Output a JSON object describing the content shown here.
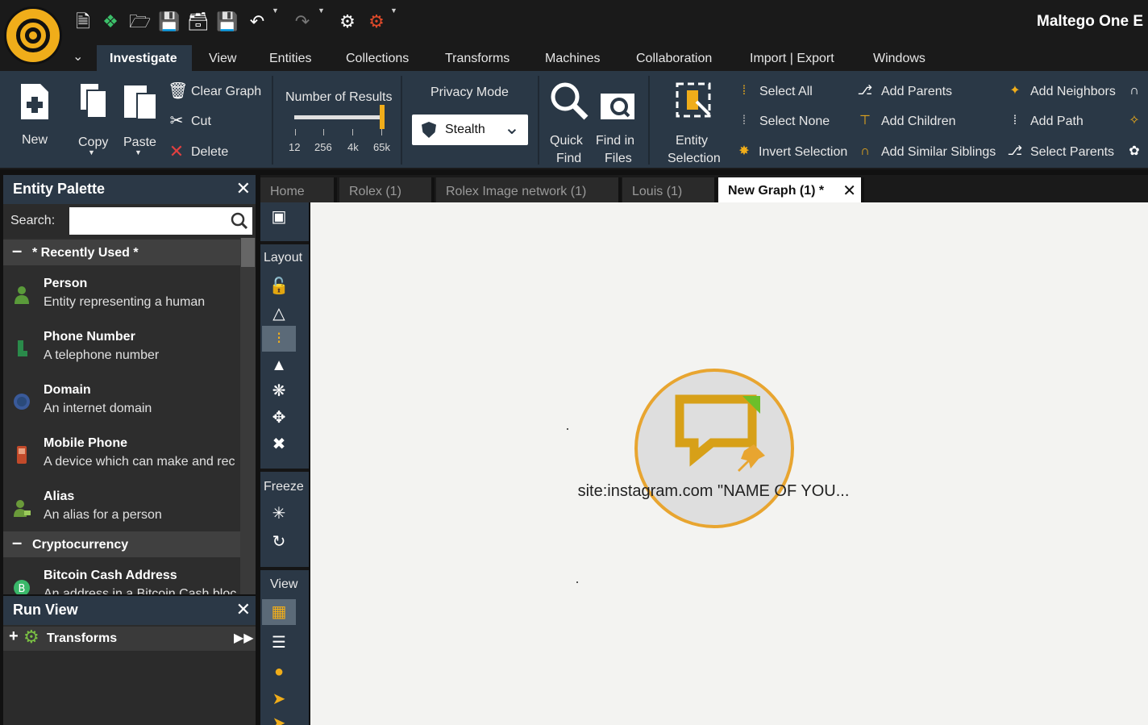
{
  "app": {
    "title": "Maltego One E"
  },
  "menu": {
    "tabs": [
      "Investigate",
      "View",
      "Entities",
      "Collections",
      "Transforms",
      "Machines",
      "Collaboration",
      "Import | Export",
      "Windows"
    ],
    "active": "Investigate"
  },
  "ribbon": {
    "new": "New",
    "copy": "Copy",
    "paste": "Paste",
    "clear_graph": "Clear Graph",
    "cut": "Cut",
    "delete": "Delete",
    "number_of_results": "Number of Results",
    "results_ticks": [
      "12",
      "256",
      "4k",
      "65k"
    ],
    "results_level": 1.0,
    "privacy_mode": "Privacy Mode",
    "privacy_value": "Stealth",
    "quick_find_1": "Quick",
    "quick_find_2": "Find",
    "find_files_1": "Find in",
    "find_files_2": "Files",
    "entity_sel_1": "Entity",
    "entity_sel_2": "Selection",
    "select_all": "Select All",
    "select_none": "Select None",
    "invert_selection": "Invert Selection",
    "add_parents": "Add Parents",
    "add_children": "Add Children",
    "add_similar_siblings": "Add Similar Siblings",
    "add_neighbors": "Add Neighbors",
    "add_path": "Add Path",
    "select_parents": "Select Parents"
  },
  "palette": {
    "title": "Entity Palette",
    "search_label": "Search:",
    "search_value": "",
    "categories": [
      {
        "label": "* Recently Used *",
        "entities": [
          {
            "name": "Person",
            "desc": "Entity representing a human",
            "icon": "person-icon"
          },
          {
            "name": "Phone Number",
            "desc": "A telephone number",
            "icon": "phone-icon"
          },
          {
            "name": "Domain",
            "desc": "An internet domain",
            "icon": "globe-icon"
          },
          {
            "name": "Mobile Phone",
            "desc": "A device which can make and rec",
            "icon": "mobile-icon"
          },
          {
            "name": "Alias",
            "desc": "An alias for a person",
            "icon": "alias-icon"
          }
        ]
      },
      {
        "label": "Cryptocurrency",
        "entities": [
          {
            "name": "Bitcoin Cash Address",
            "desc": "An address in a Bitcoin Cash bloc",
            "icon": "bitcoin-icon"
          }
        ]
      }
    ]
  },
  "runview": {
    "title": "Run View",
    "transforms": "Transforms"
  },
  "tools": {
    "layout": "Layout",
    "freeze": "Freeze",
    "view": "View"
  },
  "doc_tabs": [
    {
      "label": "Home"
    },
    {
      "label": "Rolex (1)"
    },
    {
      "label": "Rolex Image network (1)"
    },
    {
      "label": "Louis (1)"
    },
    {
      "label": "New Graph (1) *",
      "active": true
    }
  ],
  "graph": {
    "node_label": "site:instagram.com \"NAME OF YOU...",
    "node_icon": "phrase-icon",
    "node_color": "#e8a530"
  },
  "colors": {
    "accent": "#f0ad1a",
    "ribbon": "#2a3846",
    "canvas": "#f3f3f1"
  }
}
